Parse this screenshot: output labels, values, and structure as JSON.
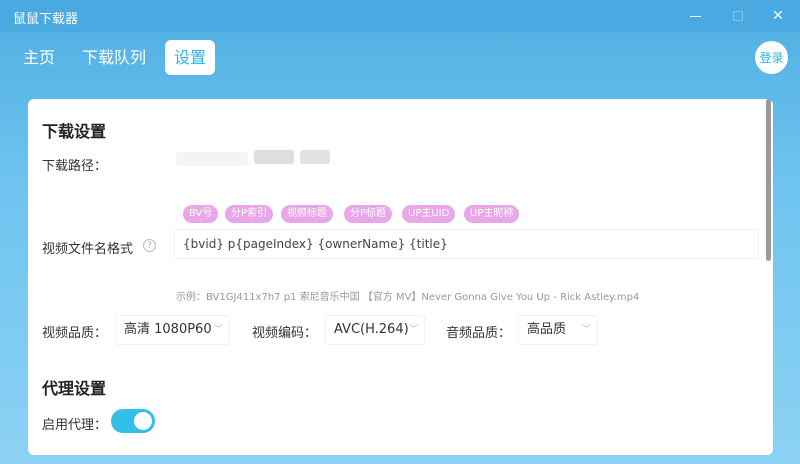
{
  "window": {
    "title": "鼠鼠下载器",
    "controls": [
      "minimize-icon",
      "maximize-icon",
      "close-icon"
    ],
    "close_glyph": "✕"
  },
  "nav": {
    "home": "主页",
    "queue": "下载队列",
    "settings": "设置",
    "active": "设置",
    "login": "登录"
  },
  "download_settings": {
    "title": "下载设置",
    "path_label": "下载路径：",
    "filename_label": "视频文件名格式",
    "help_glyph": "?",
    "tags": [
      "BV号",
      "分P索引",
      "视频标题",
      "分P标题",
      "UP主UID",
      "UP主昵称"
    ],
    "filename_format": "{bvid} p{pageIndex} {ownerName} {title}",
    "example": "示例：BV1GJ411x7h7 p1 索尼音乐中国 【官方 MV】Never Gonna Give You Up - Rick Astley.mp4",
    "video_quality_label": "视频品质：",
    "video_quality": "高清 1080P60",
    "video_codec_label": "视频编码：",
    "video_codec": "AVC(H.264)",
    "audio_quality_label": "音频品质：",
    "audio_quality": "高品质"
  },
  "proxy_settings": {
    "title": "代理设置",
    "enable_label": "启用代理：",
    "enabled": true
  },
  "colors": {
    "accent": "#33bfe8",
    "tag": "#e9a6e8",
    "background": "#6ec4ef"
  }
}
